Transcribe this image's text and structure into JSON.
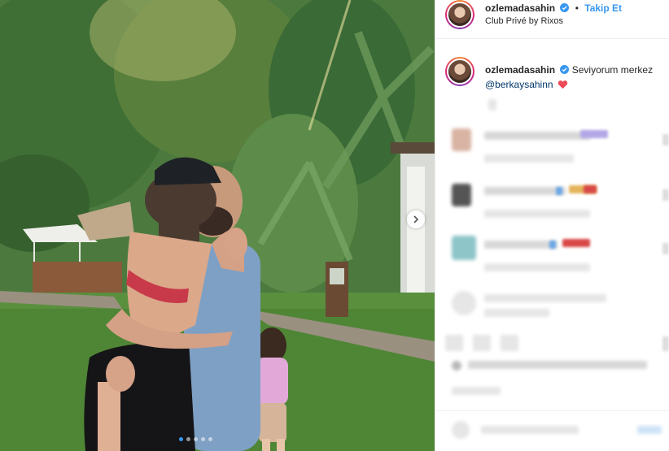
{
  "post": {
    "username": "ozlemadasahin",
    "follow_label": "Takip Et",
    "separator": "•",
    "location": "Club Privé by Rixos",
    "caption_text": "Seviyorum merkez",
    "caption_mention": "@berkaysahinn",
    "verified": true
  },
  "carousel": {
    "slide_count": 5,
    "active_slide": 1
  },
  "colors": {
    "accent": "#3897f0",
    "text": "#262626",
    "mention": "#00376b",
    "heart": "#ed4956"
  }
}
